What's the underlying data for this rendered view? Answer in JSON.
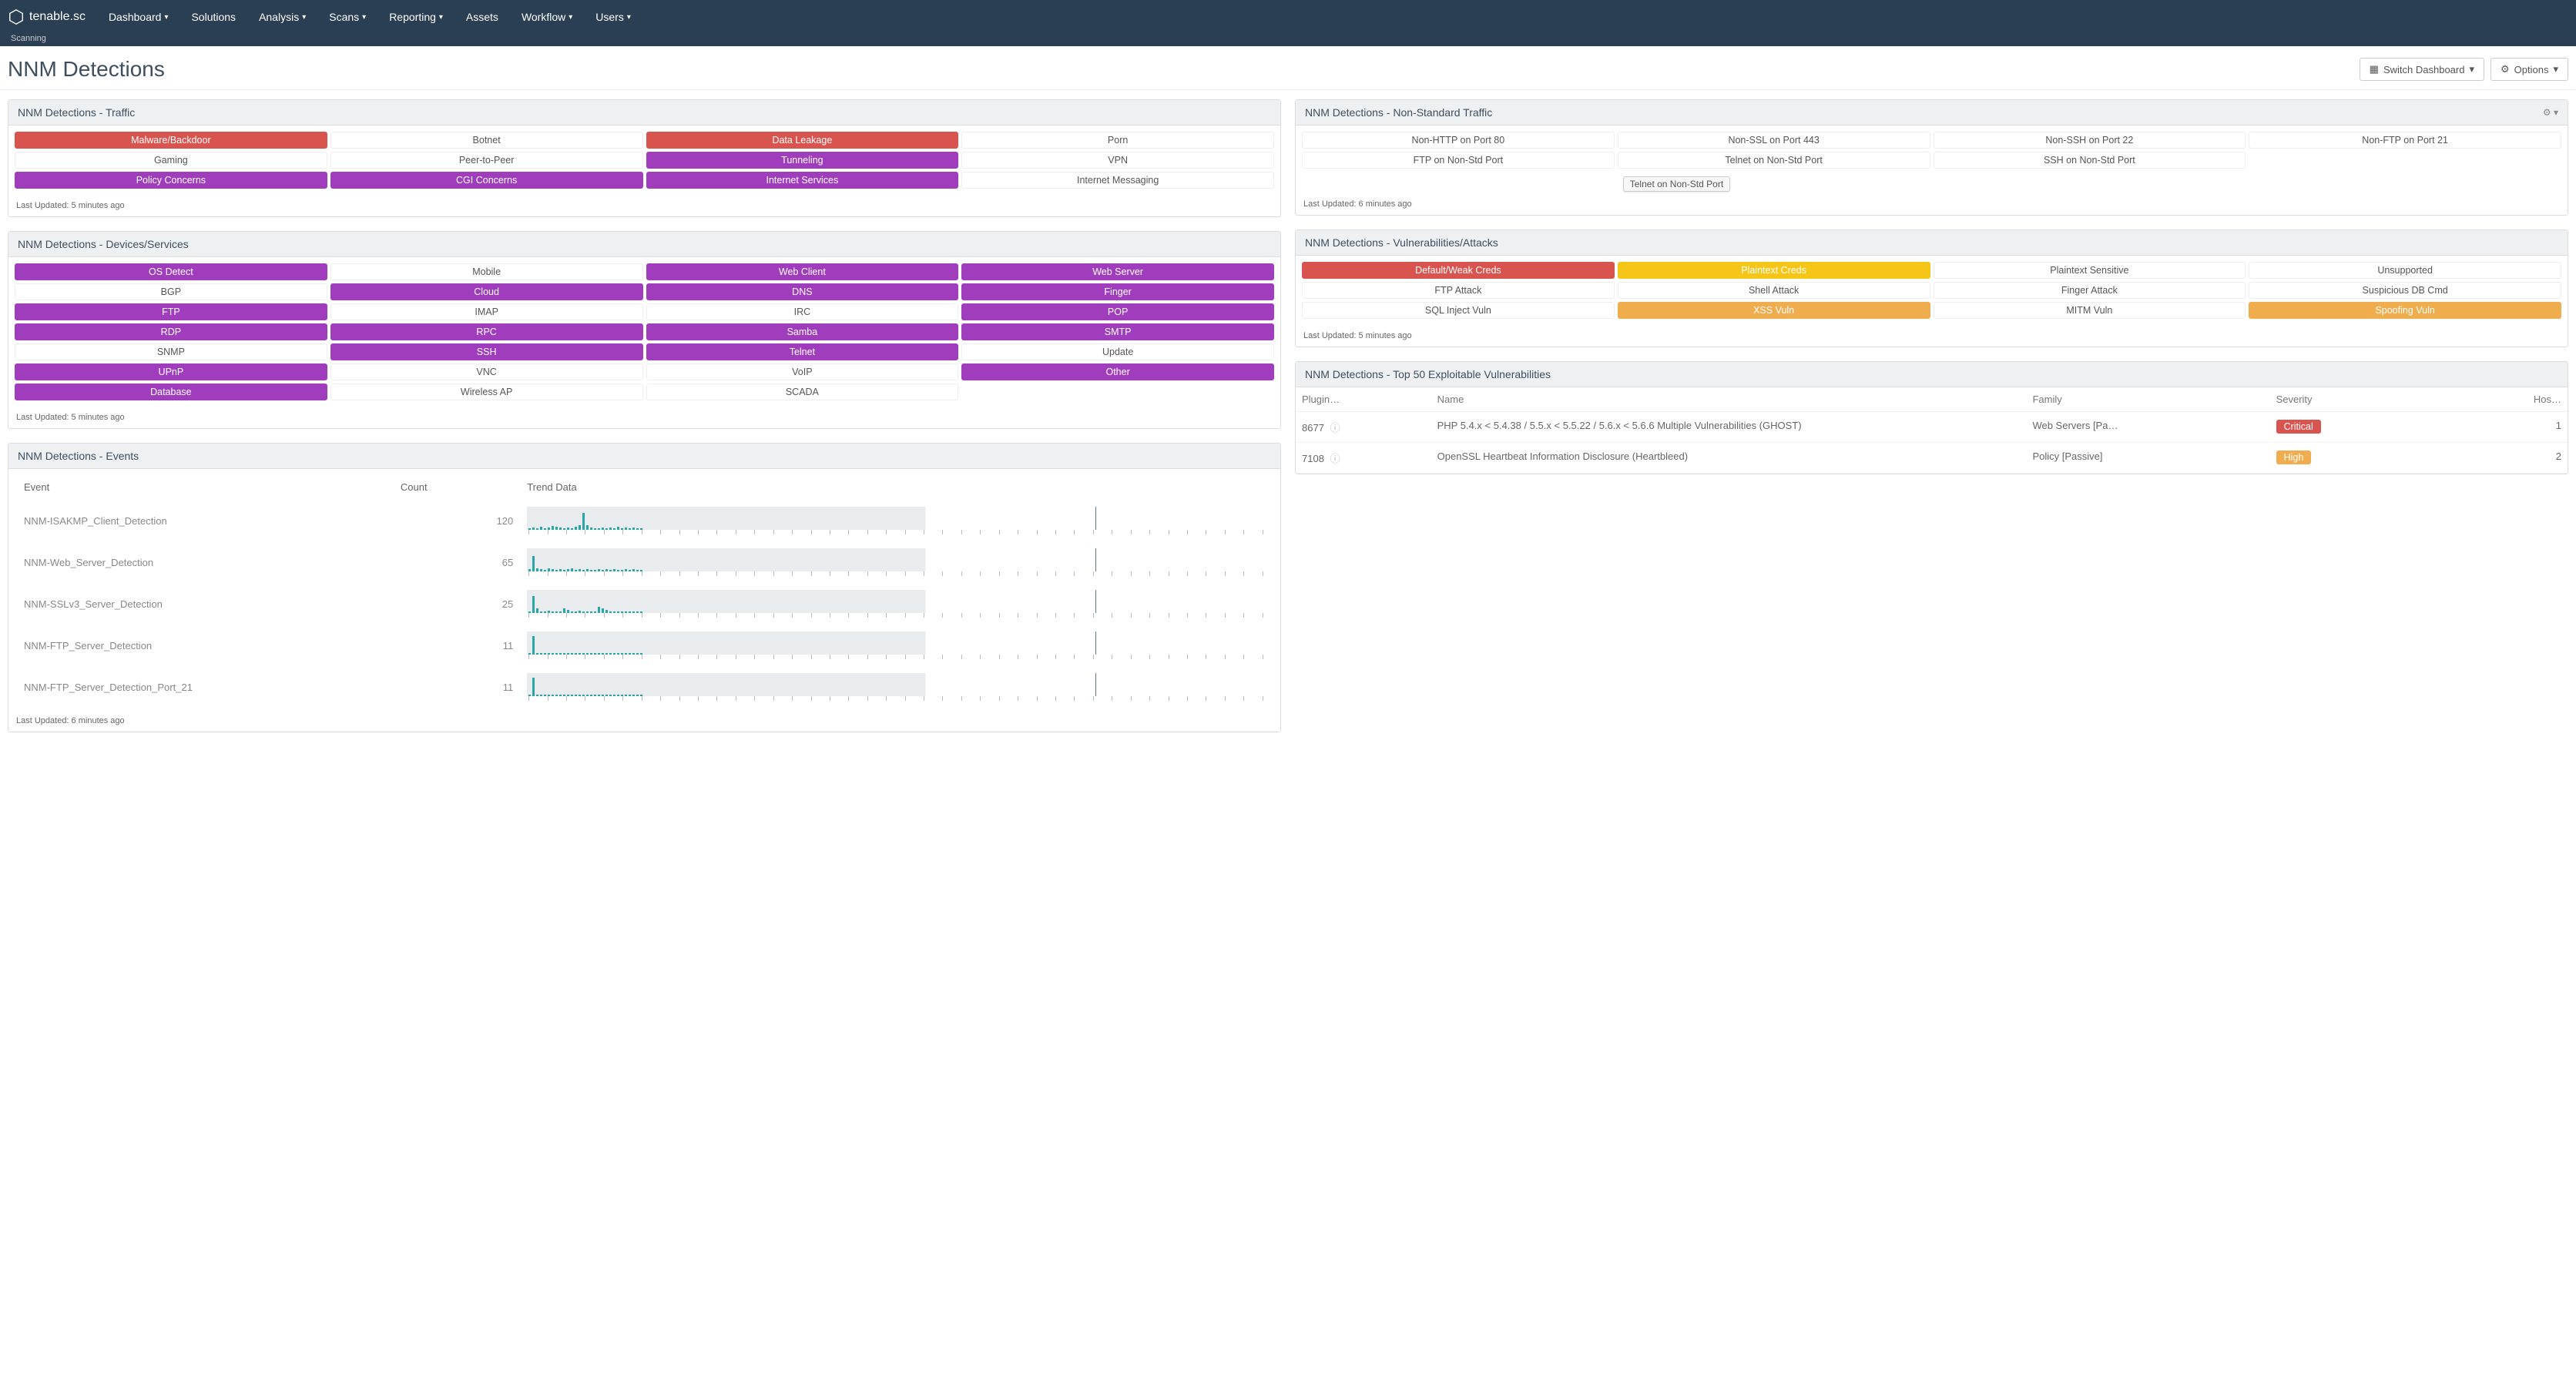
{
  "brand": "tenable.sc",
  "sub_bar": "Scanning",
  "nav": [
    "Dashboard",
    "Solutions",
    "Analysis",
    "Scans",
    "Reporting",
    "Assets",
    "Workflow",
    "Users"
  ],
  "nav_has_caret": [
    true,
    false,
    true,
    true,
    true,
    false,
    true,
    true
  ],
  "page_title": "NNM Detections",
  "switch_dashboard": "Switch Dashboard",
  "options": "Options",
  "cards": {
    "traffic": {
      "title": "NNM Detections - Traffic",
      "rows": [
        [
          {
            "t": "Malware/Backdoor",
            "c": "red"
          },
          {
            "t": "Botnet",
            "c": "plain"
          },
          {
            "t": "Data Leakage",
            "c": "red"
          },
          {
            "t": "Porn",
            "c": "plain"
          }
        ],
        [
          {
            "t": "Gaming",
            "c": "plain"
          },
          {
            "t": "Peer-to-Peer",
            "c": "plain"
          },
          {
            "t": "Tunneling",
            "c": "purple"
          },
          {
            "t": "VPN",
            "c": "plain"
          }
        ],
        [
          {
            "t": "Policy Concerns",
            "c": "purple"
          },
          {
            "t": "CGI Concerns",
            "c": "purple"
          },
          {
            "t": "Internet Services",
            "c": "purple"
          },
          {
            "t": "Internet Messaging",
            "c": "plain"
          }
        ]
      ],
      "updated": "Last Updated: 5 minutes ago"
    },
    "nonstd": {
      "title": "NNM Detections - Non-Standard Traffic",
      "rows": [
        [
          {
            "t": "Non-HTTP on Port 80",
            "c": "plain"
          },
          {
            "t": "Non-SSL on Port 443",
            "c": "plain"
          },
          {
            "t": "Non-SSH on Port 22",
            "c": "plain"
          },
          {
            "t": "Non-FTP on Port 21",
            "c": "plain"
          }
        ],
        [
          {
            "t": "FTP on Non-Std Port",
            "c": "plain"
          },
          {
            "t": "Telnet on Non-Std Port",
            "c": "plain"
          },
          {
            "t": "SSH on Non-Std Port",
            "c": "plain"
          },
          {
            "t": "",
            "c": "plain"
          }
        ]
      ],
      "tooltip": "Telnet on Non-Std Port",
      "updated": "Last Updated: 6 minutes ago"
    },
    "devices": {
      "title": "NNM Detections - Devices/Services",
      "rows": [
        [
          {
            "t": "OS Detect",
            "c": "purple"
          },
          {
            "t": "Mobile",
            "c": "plain"
          },
          {
            "t": "Web Client",
            "c": "purple"
          },
          {
            "t": "Web Server",
            "c": "purple"
          }
        ],
        [
          {
            "t": "BGP",
            "c": "plain"
          },
          {
            "t": "Cloud",
            "c": "purple"
          },
          {
            "t": "DNS",
            "c": "purple"
          },
          {
            "t": "Finger",
            "c": "purple"
          }
        ],
        [
          {
            "t": "FTP",
            "c": "purple"
          },
          {
            "t": "IMAP",
            "c": "plain"
          },
          {
            "t": "IRC",
            "c": "plain"
          },
          {
            "t": "POP",
            "c": "purple"
          }
        ],
        [
          {
            "t": "RDP",
            "c": "purple"
          },
          {
            "t": "RPC",
            "c": "purple"
          },
          {
            "t": "Samba",
            "c": "purple"
          },
          {
            "t": "SMTP",
            "c": "purple"
          }
        ],
        [
          {
            "t": "SNMP",
            "c": "plain"
          },
          {
            "t": "SSH",
            "c": "purple"
          },
          {
            "t": "Telnet",
            "c": "purple"
          },
          {
            "t": "Update",
            "c": "plain"
          }
        ],
        [
          {
            "t": "UPnP",
            "c": "purple"
          },
          {
            "t": "VNC",
            "c": "plain"
          },
          {
            "t": "VoIP",
            "c": "plain"
          },
          {
            "t": "Other",
            "c": "purple"
          }
        ],
        [
          {
            "t": "Database",
            "c": "purple"
          },
          {
            "t": "Wireless AP",
            "c": "plain"
          },
          {
            "t": "SCADA",
            "c": "plain"
          },
          {
            "t": "",
            "c": "plain"
          }
        ]
      ],
      "updated": "Last Updated: 5 minutes ago"
    },
    "vuln": {
      "title": "NNM Detections - Vulnerabilities/Attacks",
      "rows": [
        [
          {
            "t": "Default/Weak Creds",
            "c": "red"
          },
          {
            "t": "Plaintext Creds",
            "c": "yellow"
          },
          {
            "t": "Plaintext Sensitive",
            "c": "plain"
          },
          {
            "t": "Unsupported",
            "c": "plain"
          }
        ],
        [
          {
            "t": "FTP Attack",
            "c": "plain"
          },
          {
            "t": "Shell Attack",
            "c": "plain"
          },
          {
            "t": "Finger Attack",
            "c": "plain"
          },
          {
            "t": "Suspicious DB Cmd",
            "c": "plain"
          }
        ],
        [
          {
            "t": "SQL Inject Vuln",
            "c": "plain"
          },
          {
            "t": "XSS Vuln",
            "c": "orange"
          },
          {
            "t": "MITM Vuln",
            "c": "plain"
          },
          {
            "t": "Spoofing Vuln",
            "c": "orange"
          }
        ]
      ],
      "updated": "Last Updated: 5 minutes ago"
    },
    "events": {
      "title": "NNM Detections - Events",
      "cols": [
        "Event",
        "Count",
        "Trend Data"
      ],
      "rows": [
        {
          "event": "NNM-ISAKMP_Client_Detection",
          "count": 120,
          "bars": [
            2,
            3,
            2,
            4,
            2,
            3,
            5,
            4,
            3,
            2,
            3,
            2,
            4,
            6,
            22,
            6,
            3,
            2,
            2,
            3,
            2,
            3,
            2,
            4,
            2,
            3,
            2,
            3,
            2,
            2
          ]
        },
        {
          "event": "NNM-Web_Server_Detection",
          "count": 65,
          "bars": [
            3,
            20,
            4,
            3,
            2,
            4,
            3,
            2,
            3,
            2,
            3,
            4,
            2,
            3,
            2,
            3,
            2,
            2,
            3,
            2,
            3,
            2,
            3,
            2,
            2,
            3,
            2,
            3,
            2,
            2
          ]
        },
        {
          "event": "NNM-SSLv3_Server_Detection",
          "count": 25,
          "bars": [
            2,
            22,
            6,
            2,
            2,
            3,
            2,
            2,
            2,
            6,
            4,
            2,
            2,
            3,
            2,
            2,
            2,
            2,
            8,
            6,
            4,
            2,
            2,
            2,
            2,
            2,
            2,
            2,
            2,
            2
          ]
        },
        {
          "event": "NNM-FTP_Server_Detection",
          "count": 11,
          "bars": [
            2,
            24,
            2,
            2,
            2,
            2,
            2,
            2,
            2,
            2,
            2,
            2,
            2,
            2,
            2,
            2,
            2,
            2,
            2,
            2,
            2,
            2,
            2,
            2,
            2,
            2,
            2,
            2,
            2,
            2
          ]
        },
        {
          "event": "NNM-FTP_Server_Detection_Port_21",
          "count": 11,
          "bars": [
            2,
            24,
            2,
            2,
            2,
            2,
            2,
            2,
            2,
            2,
            2,
            2,
            2,
            2,
            2,
            2,
            2,
            2,
            2,
            2,
            2,
            2,
            2,
            2,
            2,
            2,
            2,
            2,
            2,
            2
          ]
        }
      ],
      "updated": "Last Updated: 6 minutes ago"
    },
    "top50": {
      "title": "NNM Detections - Top 50 Exploitable Vulnerabilities",
      "cols": [
        "Plugin…",
        "Name",
        "Family",
        "Severity",
        "Hos…"
      ],
      "rows": [
        {
          "plugin": "8677",
          "name": "PHP 5.4.x < 5.4.38 / 5.5.x < 5.5.22 / 5.6.x < 5.6.6 Multiple Vulnerabilities (GHOST)",
          "family": "Web Servers [Pa…",
          "severity": "Critical",
          "hosts": 1
        },
        {
          "plugin": "7108",
          "name": "OpenSSL Heartbeat Information Disclosure (Heartbleed)",
          "family": "Policy [Passive]",
          "severity": "High",
          "hosts": 2
        }
      ]
    }
  }
}
